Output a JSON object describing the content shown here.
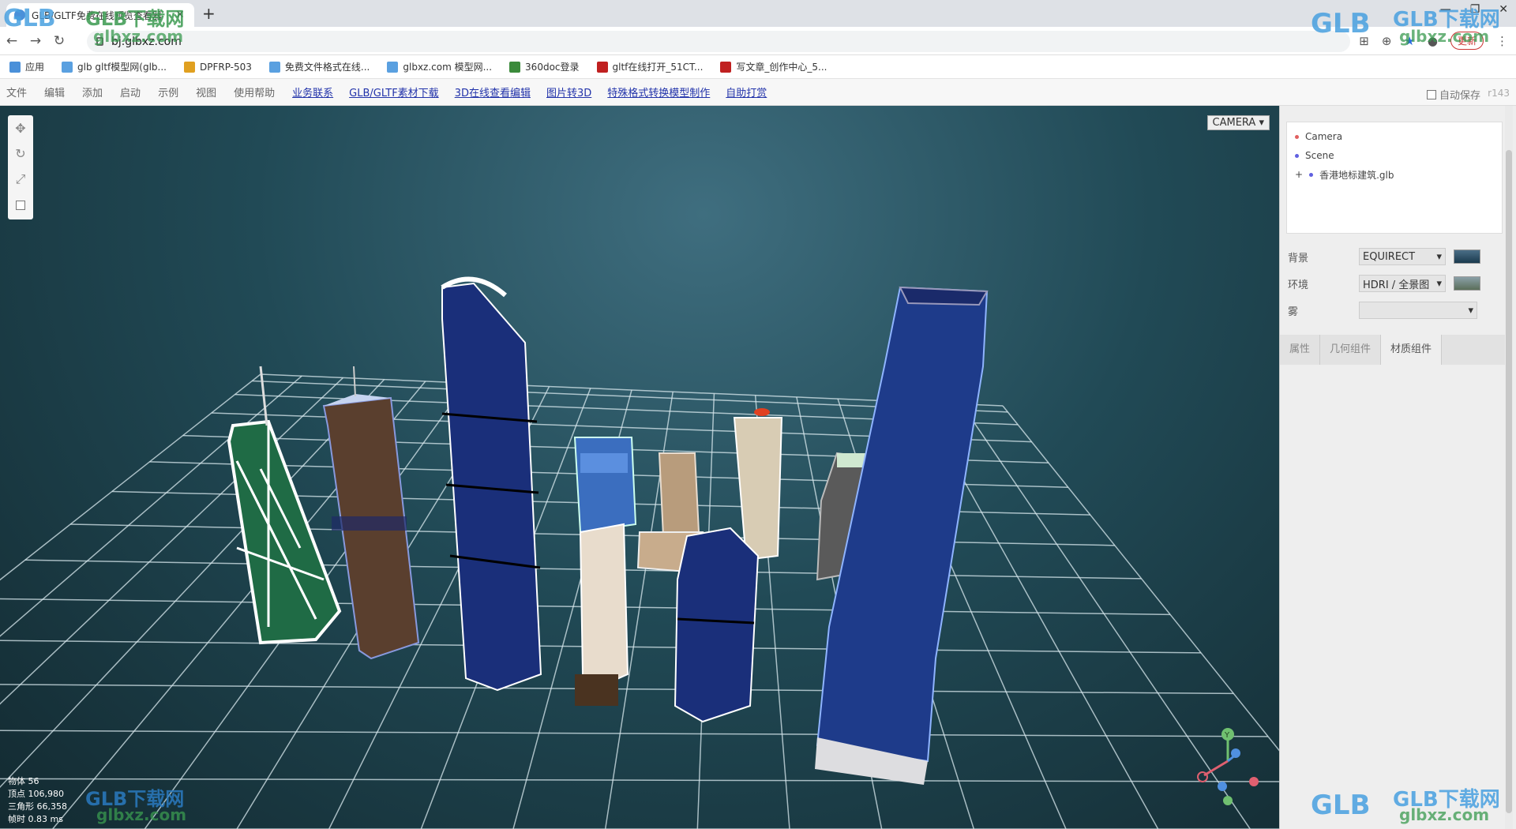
{
  "browser": {
    "tab_title": "GLB/GLTF免费在线预览查看器",
    "address": "bj.glbxz.com",
    "update_label": "更新"
  },
  "bookmarks": [
    {
      "label": "应用",
      "color": "#4a90d9"
    },
    {
      "label": "glb gltf模型网(glb...",
      "color": "#5aa0e0"
    },
    {
      "label": "DPFRP-503",
      "color": "#e0a020"
    },
    {
      "label": "免费文件格式在线...",
      "color": "#5aa0e0"
    },
    {
      "label": "glbxz.com 模型网...",
      "color": "#5aa0e0"
    },
    {
      "label": "360doc登录",
      "color": "#3a8a3a"
    },
    {
      "label": "gltf在线打开_51CT...",
      "color": "#c02020"
    },
    {
      "label": "写文章_创作中心_5...",
      "color": "#c02020"
    }
  ],
  "menu": {
    "items": [
      "文件",
      "编辑",
      "添加",
      "启动",
      "示例",
      "视图",
      "使用帮助"
    ],
    "links": [
      "业务联系",
      "GLB/GLTF素材下载",
      "3D在线查看编辑",
      "图片转3D",
      "特殊格式转换模型制作",
      "自助打赏"
    ],
    "autosave_label": "自动保存",
    "version": "r143"
  },
  "viewport": {
    "camera_label": "CAMERA",
    "stats": {
      "objects": "物体 56",
      "vertices": "顶点 106,980",
      "triangles": "三角形 66,358",
      "frametime": "帧时 0.83 ms"
    },
    "axis_label_y": "Y"
  },
  "outliner": {
    "items": [
      {
        "label": "Camera",
        "color": "#e06060"
      },
      {
        "label": "Scene",
        "color": "#6060e0"
      },
      {
        "label": "香港地标建筑.glb",
        "color": "#6060e0",
        "prefix": "+"
      }
    ]
  },
  "properties": {
    "background": {
      "label": "背景",
      "value": "EQUIRECT"
    },
    "environment": {
      "label": "环境",
      "value": "HDRI / 全景图"
    },
    "fog": {
      "label": "雾",
      "value": ""
    },
    "tabs": [
      "属性",
      "几何组件",
      "材质组件"
    ]
  },
  "watermark": {
    "brand": "GLB下载网",
    "domain": "glbxz.com",
    "logo": "GLB"
  }
}
